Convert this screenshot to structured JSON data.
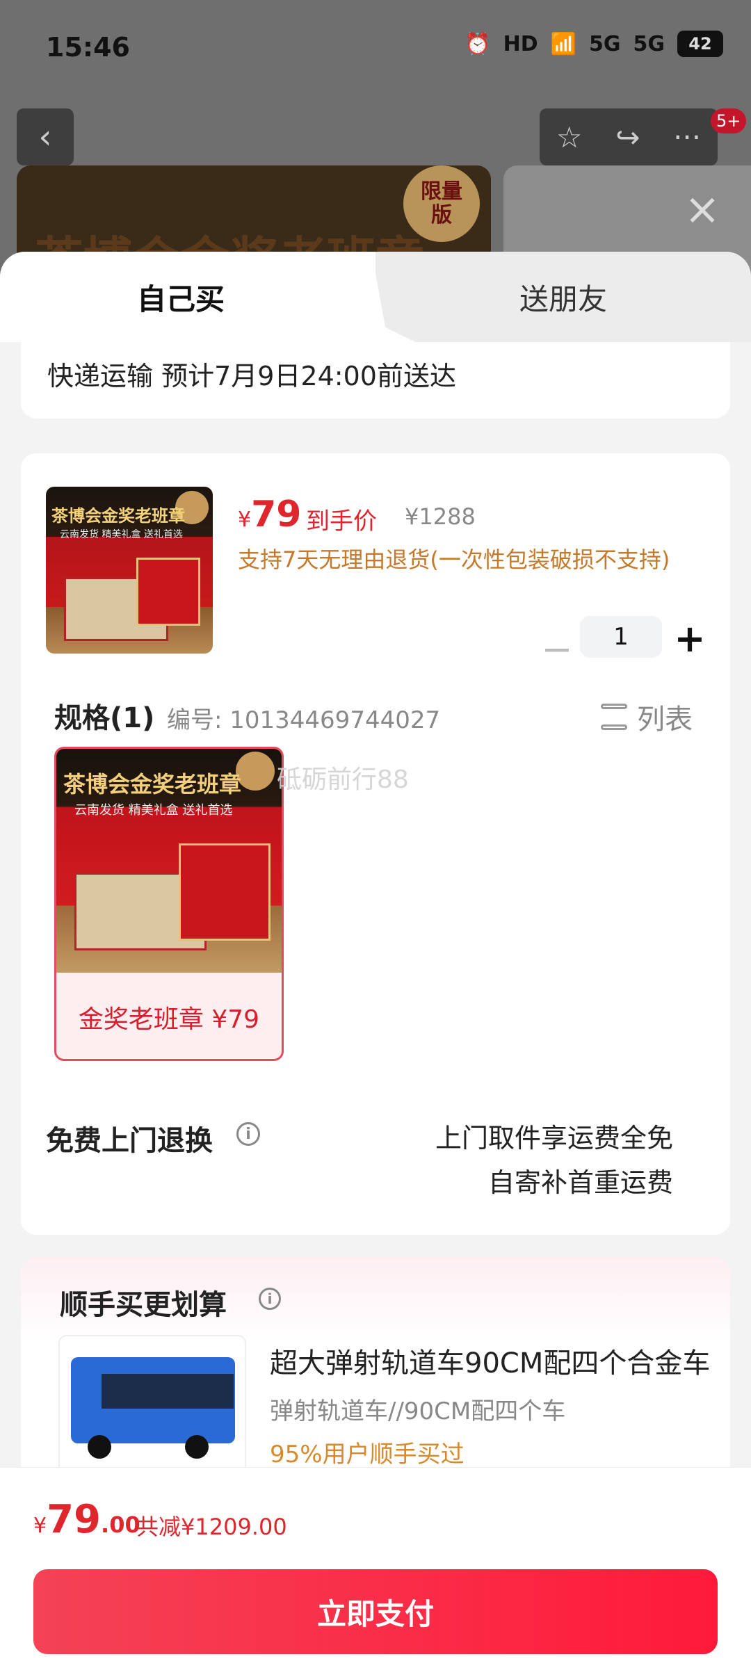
{
  "status_bar": {
    "time": "15:46",
    "hd": "HD",
    "net1": "5G",
    "net2": "5G",
    "battery": "42"
  },
  "top_nav": {
    "back": "‹",
    "star": "☆",
    "share": "↪",
    "more": "···",
    "badge": "5+"
  },
  "banner": {
    "text": "茶博会金奖老班章",
    "seal": "限量\n版"
  },
  "close": "×",
  "tabs": {
    "self": "自己买",
    "friend": "送朋友"
  },
  "shipping": {
    "text": "快递运输 预计7月9日24:00前送达"
  },
  "product": {
    "thumb_title": "茶博会金奖老班章",
    "thumb_sub": "云南发货 精美礼盒 送礼首选",
    "currency": "¥",
    "price": "79",
    "price_tag": "到手价",
    "original_price": "¥1288",
    "return_policy": "支持7天无理由退货(一次性包装破损不支持)",
    "quantity": "1"
  },
  "spec": {
    "label": "规格(1)",
    "number": "编号: 10134469744027",
    "list_label": "列表",
    "option_title": "茶博会金奖老班章",
    "option_sub": "云南发货 精美礼盒 送礼首选",
    "option_label": "金奖老班章 ¥79",
    "watermark": "砥砺前行88"
  },
  "free_return": {
    "title": "免费上门退换",
    "line1": "上门取件享运费全免",
    "line2": "自寄补首重运费"
  },
  "upsell": {
    "title": "顺手买更划算",
    "item_name": "超大弹射轨道车90CM配四个合金车",
    "item_spec": "弹射轨道车//90CM配四个车",
    "item_note": "95%用户顺手买过"
  },
  "bottom_bar": {
    "currency": "¥",
    "total_int": "79",
    "total_dec": ".00",
    "reduction": "共减¥1209.00",
    "pay_button": "立即支付"
  }
}
